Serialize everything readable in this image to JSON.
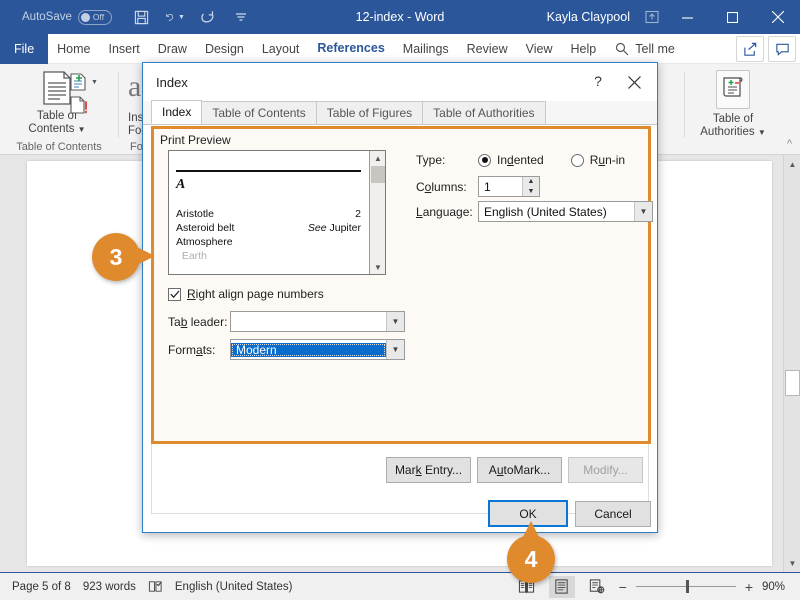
{
  "titlebar": {
    "autosave_label": "AutoSave",
    "autosave_state": "Off",
    "document_title": "12-index - Word",
    "account_name": "Kayla Claypool",
    "qat": [
      "save-icon",
      "undo-icon",
      "redo-icon",
      "customize-qat-icon"
    ],
    "window_buttons": [
      "minimize",
      "restore",
      "close"
    ],
    "bg_color": "#2b579a"
  },
  "ribbon": {
    "tabs": [
      {
        "label": "File",
        "active": false,
        "is_file": true
      },
      {
        "label": "Home",
        "active": false
      },
      {
        "label": "Insert",
        "active": false
      },
      {
        "label": "Draw",
        "active": false
      },
      {
        "label": "Design",
        "active": false
      },
      {
        "label": "Layout",
        "active": false
      },
      {
        "label": "References",
        "active": true
      },
      {
        "label": "Mailings",
        "active": false
      },
      {
        "label": "Review",
        "active": false
      },
      {
        "label": "View",
        "active": false
      },
      {
        "label": "Help",
        "active": false
      }
    ],
    "tell_me": "Tell me",
    "share_icon": "share-icon",
    "comments_icon": "comments-icon",
    "groups": [
      {
        "label": "Table of Contents",
        "main_button": "Table of\nContents"
      },
      {
        "label": "Footnotes",
        "partial_label": "Fo",
        "main_button": "Insert\nFootnote"
      },
      {
        "label": "Table of Authorities",
        "main_button": "Table of\nAuthorities"
      }
    ],
    "toc_button_line1": "Table of",
    "toc_button_line2": "Contents",
    "toc_group_label": "Table of Contents",
    "footnote_group_partial": "Fo",
    "footnote_line1": "Ins",
    "footnote_line2": "Foo",
    "toa_button_line1": "Table of",
    "toa_button_line2": "Authorities"
  },
  "dialog": {
    "title": "Index",
    "help_glyph": "?",
    "tabs": [
      {
        "label": "Index",
        "active": true
      },
      {
        "label": "Table of Contents",
        "active": false
      },
      {
        "label": "Table of Figures",
        "active": false
      },
      {
        "label": "Table of Authorities",
        "active": false
      }
    ],
    "print_preview_label": "Print Preview",
    "preview": {
      "letter_heading": "A",
      "entries": [
        {
          "term": "Aristotle",
          "page": "2"
        },
        {
          "term": "Asteroid belt",
          "page": "See Jupiter",
          "italic_prefix": "See",
          "page_plain": "Jupiter"
        },
        {
          "term": "Atmosphere",
          "page": ""
        }
      ]
    },
    "type_label": "Type:",
    "type_options": [
      {
        "label": "Indented",
        "selected": true
      },
      {
        "label": "Run-in",
        "selected": false
      }
    ],
    "columns_label": "Columns:",
    "columns_value": "1",
    "language_label": "Language:",
    "language_value": "English (United States)",
    "right_align_label": "Right align page numbers",
    "right_align_checked": true,
    "tab_leader_label": "Tab leader:",
    "tab_leader_value": "",
    "formats_label": "Formats:",
    "formats_value": "Modern",
    "buttons": {
      "mark_entry": "Mark Entry...",
      "automark": "AutoMark...",
      "modify": "Modify...",
      "modify_disabled": true,
      "ok": "OK",
      "cancel": "Cancel"
    },
    "highlight_color": "#e08a2e",
    "border_color": "#2b80c8"
  },
  "callouts": [
    {
      "number": "3",
      "direction": "right"
    },
    {
      "number": "4",
      "direction": "up"
    }
  ],
  "statusbar": {
    "page_info": "Page 5 of 8",
    "word_count": "923 words",
    "proofing_icon": "proofing-icon",
    "language": "English (United States)",
    "view_buttons": [
      "read-mode-icon",
      "print-layout-icon",
      "web-layout-icon"
    ],
    "active_view_index": 1,
    "zoom_out": "−",
    "zoom_in": "+",
    "zoom_level": "90%"
  }
}
